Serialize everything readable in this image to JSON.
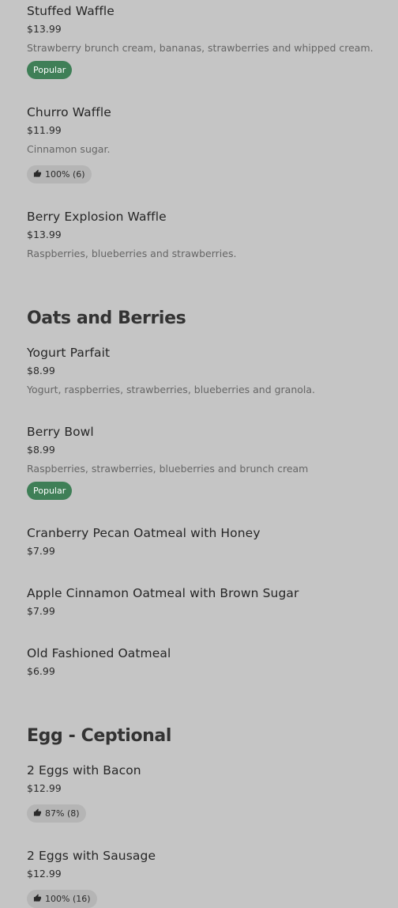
{
  "sections": [
    {
      "items": [
        {
          "name": "Stuffed Waffle",
          "price": "$13.99",
          "description": "Strawberry brunch cream, bananas, strawberries and whipped cream.",
          "badge": "Popular"
        },
        {
          "name": "Churro Waffle",
          "price": "$11.99",
          "description": "Cinnamon sugar.",
          "rating": "100% (6)"
        },
        {
          "name": "Berry Explosion Waffle",
          "price": "$13.99",
          "description": "Raspberries, blueberries and strawberries."
        }
      ]
    },
    {
      "title": "Oats and Berries",
      "items": [
        {
          "name": "Yogurt Parfait",
          "price": "$8.99",
          "description": "Yogurt, raspberries, strawberries, blueberries and granola."
        },
        {
          "name": "Berry Bowl",
          "price": "$8.99",
          "description": "Raspberries, strawberries, blueberries and brunch cream",
          "badge": "Popular"
        },
        {
          "name": "Cranberry Pecan Oatmeal with Honey",
          "price": "$7.99"
        },
        {
          "name": "Apple Cinnamon Oatmeal with Brown Sugar",
          "price": "$7.99"
        },
        {
          "name": "Old Fashioned Oatmeal",
          "price": "$6.99"
        }
      ]
    },
    {
      "title": "Egg - Ceptional",
      "items": [
        {
          "name": "2 Eggs with Bacon",
          "price": "$12.99",
          "rating": "87% (8)"
        },
        {
          "name": "2 Eggs with Sausage",
          "price": "$12.99",
          "rating": "100% (16)"
        }
      ]
    }
  ],
  "icons": {
    "rating": "thumbs-up-icon"
  },
  "colors": {
    "popular_badge": "#3f7f57",
    "rating_badge": "#b5b5b5",
    "background": "#c5c5c5"
  }
}
